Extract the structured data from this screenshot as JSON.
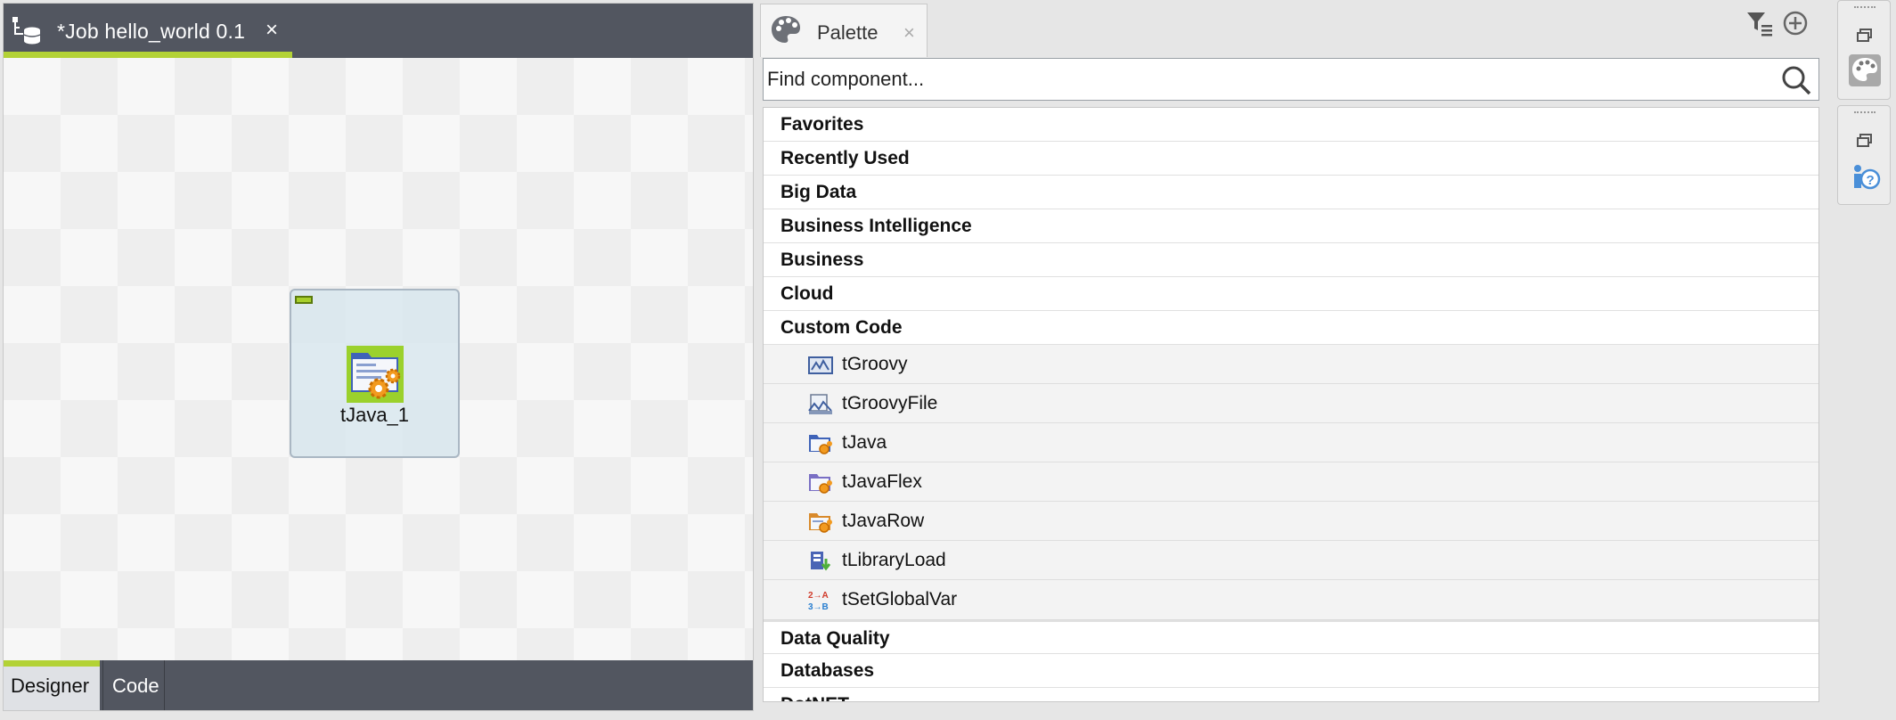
{
  "editor": {
    "tab_title": "*Job hello_world 0.1",
    "tab_close": "×",
    "component_label": "tJava_1",
    "footer_tabs": [
      {
        "label": "Designer"
      },
      {
        "label": "Code"
      }
    ]
  },
  "palette": {
    "title": "Palette",
    "close": "×",
    "search_placeholder": "Find component...",
    "categories_before": [
      {
        "label": "Favorites"
      },
      {
        "label": "Recently Used"
      },
      {
        "label": "Big Data"
      },
      {
        "label": "Business Intelligence"
      },
      {
        "label": "Business"
      },
      {
        "label": "Cloud"
      },
      {
        "label": "Custom Code"
      }
    ],
    "custom_code_components": [
      {
        "label": "tGroovy",
        "icon": "groovy-icon"
      },
      {
        "label": "tGroovyFile",
        "icon": "groovy-file-icon"
      },
      {
        "label": "tJava",
        "icon": "java-icon"
      },
      {
        "label": "tJavaFlex",
        "icon": "java-flex-icon"
      },
      {
        "label": "tJavaRow",
        "icon": "java-row-icon"
      },
      {
        "label": "tLibraryLoad",
        "icon": "library-load-icon"
      },
      {
        "label": "tSetGlobalVar",
        "icon": "set-global-var-icon"
      }
    ],
    "categories_after": [
      {
        "label": "Data Quality"
      },
      {
        "label": "Databases"
      },
      {
        "label": "DotNET"
      }
    ]
  },
  "colors": {
    "header_bg": "#525660",
    "accent_green": "#b3d236",
    "component_orange": "#f29a1f"
  }
}
